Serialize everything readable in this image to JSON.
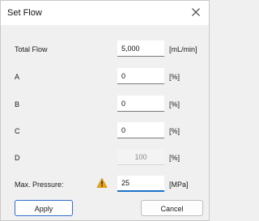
{
  "window": {
    "title": "Set Flow",
    "close_icon": "close-icon"
  },
  "rows": [
    {
      "label": "Total Flow",
      "value": "5,000",
      "unit": "[mL/min]",
      "state": "enabled"
    },
    {
      "label": "A",
      "value": "0",
      "unit": "[%]",
      "state": "enabled"
    },
    {
      "label": "B",
      "value": "0",
      "unit": "[%]",
      "state": "enabled"
    },
    {
      "label": "C",
      "value": "0",
      "unit": "[%]",
      "state": "enabled"
    },
    {
      "label": "D",
      "value": "100",
      "unit": "[%]",
      "state": "disabled"
    },
    {
      "label": "Max. Pressure:",
      "value": "25",
      "unit": "[MPa]",
      "state": "focused",
      "icon": "warning-icon"
    }
  ],
  "buttons": {
    "apply_label": "Apply",
    "cancel_label": "Cancel"
  },
  "colors": {
    "focus_accent": "#1a73c8",
    "primary_border": "#2f6fc6",
    "warning": "#e8a317"
  }
}
